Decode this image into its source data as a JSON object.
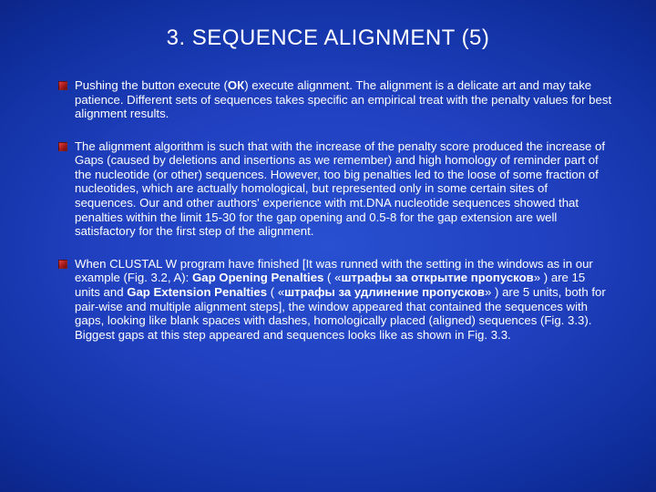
{
  "title": "3. SEQUENCE ALIGNMENT (5)",
  "items": [
    {
      "p1a": "Pushing the button execute (",
      "p1b": "ОК",
      "p1c": ") execute alignment. The alignment is a delicate art and may take patience. Different sets of sequences takes specific an empirical treat with the penalty values for best alignment results."
    },
    {
      "p2": "The alignment algorithm is such that with the increase of the penalty score produced the increase of Gaps (caused by deletions and insertions as we remember) and high homology of reminder part of the nucleotide (or other) sequences. However, too big penalties led to the loose of some fraction of nucleotides, which are actually homological, but represented only in some certain sites of sequences. Our and other authors' experience with mt.DNA nucleotide sequences showed that penalties within the limit 15-30 for the gap opening and 0.5-8 for the gap extension are well satisfactory for the first step of the alignment."
    },
    {
      "p3a": "When CLUSTAL W program have finished [It was runned with the setting in the windows as in our example (Fig. 3.2, A): ",
      "p3b": "Gap Opening Penalties",
      "p3c": " ( «",
      "p3d": "штрафы за открытие пропусков",
      "p3e": "» ) are 15 units and ",
      "p3f": "Gap Extension Penalties",
      "p3g": " ( «",
      "p3h": "штрафы за удлинение пропусков",
      "p3i": "» ) are 5 units, both for pair-wise and multiple alignment steps], the window appeared that contained the sequences with gaps, looking like blank spaces with dashes, homologically placed (aligned) sequences (Fig. 3.3). Biggest gaps at this step appeared and sequences looks like as shown in Fig. 3.3."
    }
  ]
}
